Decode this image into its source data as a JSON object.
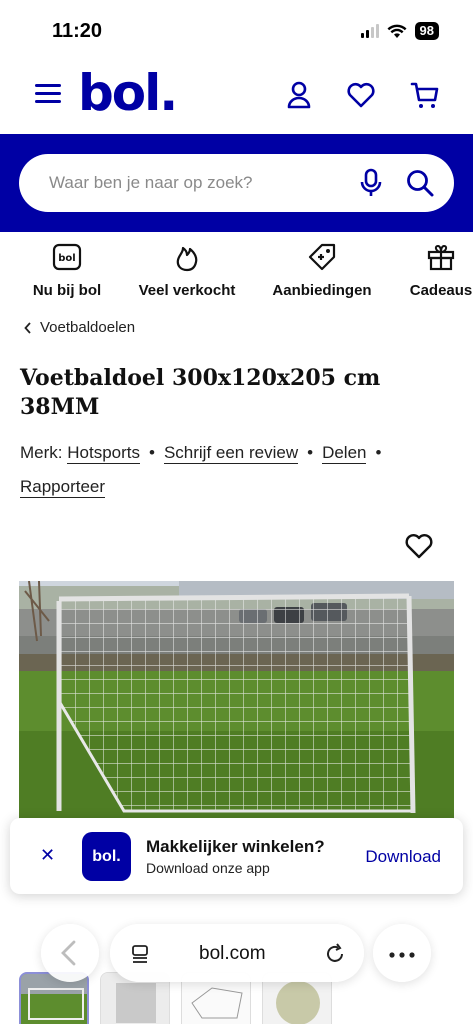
{
  "status_bar": {
    "time": "11:20",
    "battery": "98"
  },
  "header": {
    "logo": "bol."
  },
  "search": {
    "placeholder": "Waar ben je naar op zoek?"
  },
  "categories": [
    {
      "label": "Nu bij bol",
      "icon": "bol-badge-icon"
    },
    {
      "label": "Veel verkocht",
      "icon": "flame-icon"
    },
    {
      "label": "Aanbiedingen",
      "icon": "price-tag-icon"
    },
    {
      "label": "Cadeaus",
      "icon": "gift-icon"
    }
  ],
  "breadcrumb": {
    "label": "Voetbaldoelen"
  },
  "product": {
    "title": "Voetbaldoel 300x120x205 cm 38MM",
    "brand_label": "Merk:",
    "brand": "Hotsports",
    "review_link": "Schrijf een review",
    "share_link": "Delen",
    "report_link": "Rapporteer"
  },
  "app_banner": {
    "logo": "bol.",
    "title": "Makkelijker winkelen?",
    "subtitle": "Download onze app",
    "download": "Download"
  },
  "browser": {
    "url": "bol.com"
  },
  "colors": {
    "brand": "#0000a4"
  }
}
